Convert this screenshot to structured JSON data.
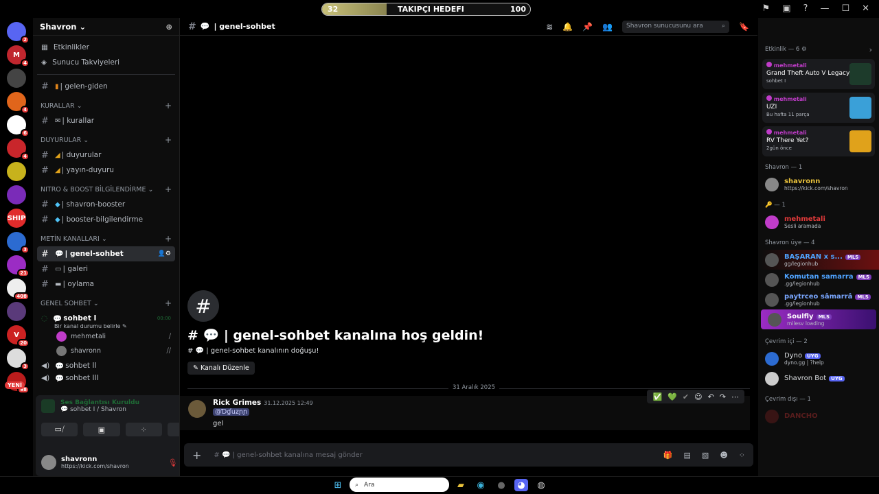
{
  "topbar": {
    "progress_left": "32",
    "progress_right": "100",
    "progress_label": "TAKIPÇI HEDEFI",
    "progress_fraction": 0.31
  },
  "servers": [
    {
      "color": "#5865f2",
      "label": "",
      "badge": "2"
    },
    {
      "color": "#c0262e",
      "label": "M",
      "badge": "4"
    },
    {
      "color": "#444",
      "label": "",
      "badge": ""
    },
    {
      "color": "#e0651b",
      "label": "",
      "badge": "4"
    },
    {
      "color": "#fff",
      "label": "",
      "badge": "6"
    },
    {
      "color": "#c9262b",
      "label": "",
      "badge": "4"
    },
    {
      "color": "#c7b21c",
      "label": "",
      "badge": ""
    },
    {
      "color": "#7a2bb8",
      "label": "",
      "badge": ""
    },
    {
      "color": "#e02b2b",
      "label": "SHIP",
      "badge": ""
    },
    {
      "color": "#2c6bd1",
      "label": "",
      "badge": "3"
    },
    {
      "color": "#9b2cc4",
      "label": "",
      "badge": "21"
    },
    {
      "color": "#eee",
      "label": "",
      "badge": "408"
    },
    {
      "color": "#5a3a7a",
      "label": "",
      "badge": ""
    },
    {
      "color": "#c22",
      "label": "V",
      "badge": "20"
    },
    {
      "color": "#ddd",
      "label": "",
      "badge": "3"
    },
    {
      "color": "#b91c1c",
      "label": "",
      "badge": "98"
    }
  ],
  "new_badge": "YENİ",
  "guild": {
    "name": "Shavron"
  },
  "nav": {
    "events": "Etkinlikler",
    "boosts": "Sunucu Takviyeleri",
    "gelen": "| gelen-giden"
  },
  "categories": {
    "kurallar": "KURALLAR",
    "duyurular": "DUYURULAR",
    "nitro": "NITRO & BOOST BİLGİLENDİRME",
    "metin": "METİN KANALLARI",
    "genel": "GENEL SOHBET"
  },
  "channels": {
    "kurallar": "| kurallar",
    "duyurular": "| duyurular",
    "yayin": "| yayın-duyuru",
    "booster": "| shavron-booster",
    "boosterbilgi": "| booster-bilgilendirme",
    "genel": "| genel-sohbet",
    "galeri": "| galeri",
    "oylama": "| oylama"
  },
  "voice": {
    "sohbet1": "sohbet I",
    "sohbet1_time": "00:00",
    "sohbet1_status": "Bir kanal durumu belirle",
    "user1": "mehmetali",
    "user2": "shavronn",
    "sohbet2": "sohbet II",
    "sohbet3": "sohbet III"
  },
  "panel": {
    "vc_status": "Ses Bağlantısı Kuruldu",
    "vc_channel": "sohbet I / Shavron",
    "user": "shavronn",
    "user_status": "https://kick.com/shavron"
  },
  "channel_header": {
    "name": "| genel-sohbet",
    "search_placeholder": "Shavron sunucusunu ara"
  },
  "welcome": {
    "title": "| genel-sohbet kanalına hoş geldin!",
    "sub": "| genel-sohbet kanalının doğuşu!",
    "edit_button": "Kanalı Düzenle"
  },
  "date_divider": "31 Aralık 2025",
  "message": {
    "author": "Rick Grimes",
    "time": "31.12.2025 12:49",
    "mention": "@Ɗɠuƶɲɲ",
    "text": "gel"
  },
  "input": {
    "placeholder": "| genel-sohbet kanalına mesaj gönder"
  },
  "members": {
    "activity_header": "Etkinlik — 6",
    "activities": [
      {
        "who": "mehmetali",
        "title": "Grand Theft Auto V Legacy",
        "sub": "sohbet I",
        "color": "#1d3b2b"
      },
      {
        "who": "mehmetali",
        "title": "UZI",
        "sub": "Bu hafta 11 parça",
        "color": "#3aa0d8"
      },
      {
        "who": "mehmetali",
        "title": "RV There Yet?",
        "sub": "2gün önce",
        "color": "#e0a21b"
      }
    ],
    "role1": "Shavron — 1",
    "owner": {
      "name": "shavronn",
      "status": "https://kick.com/shavron"
    },
    "role2": "— 1",
    "admin": {
      "name": "mehmetali",
      "status": "Sesli aramada"
    },
    "role3": "Shavron üye — 4",
    "users": [
      {
        "name": "BAŞARAN x s...",
        "status": "gg/legionhub",
        "color": "#4fa3ff"
      },
      {
        "name": "Komutan samarra",
        "status": ".gg/legionhub",
        "color": "#4fa3ff"
      },
      {
        "name": "paytrceo sâmarrâ",
        "status": ".gg/legionhub",
        "color": "#7aa7ff"
      },
      {
        "name": "Soulfly",
        "status": "milesv loading",
        "color": "#ffffff"
      }
    ],
    "online_header": "Çevrim içi — 2",
    "bots": [
      {
        "name": "Dyno",
        "status": "dyno.gg | ?help",
        "tag": "UYG"
      },
      {
        "name": "Shavron Bot",
        "status": "",
        "tag": "UYG"
      }
    ],
    "offline_header": "Çevrim dışı — 1",
    "offline_user": "DANCHO",
    "tag": "MLS"
  },
  "taskbar": {
    "search": "Ara"
  }
}
